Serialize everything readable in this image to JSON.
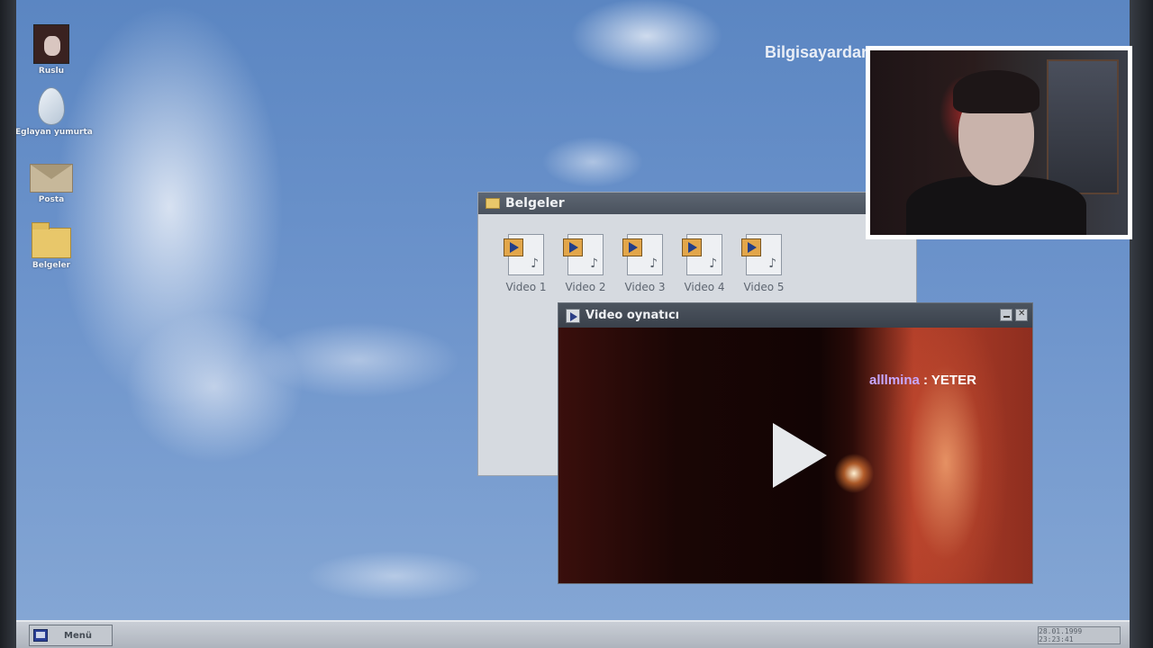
{
  "desktop": {
    "icons": [
      {
        "label": "Ruslu",
        "icon": "doll-icon"
      },
      {
        "label": "Eglayan yumurta",
        "icon": "egg-icon"
      },
      {
        "label": "Posta",
        "icon": "mail-icon"
      },
      {
        "label": "Belgeler",
        "icon": "folder-icon"
      }
    ],
    "overlay_text": "Bilgisayardan g"
  },
  "belgeler_window": {
    "title": "Belgeler",
    "files": [
      "Video 1",
      "Video 2",
      "Video 3",
      "Video 4",
      "Video 5"
    ]
  },
  "video_window": {
    "title": "Video oynatıcı"
  },
  "chat": {
    "user": "alllmina",
    "separator": " : ",
    "message": "YETER"
  },
  "taskbar": {
    "menu_label": "Menü",
    "clock": "28.01.1999 23:23:41"
  }
}
